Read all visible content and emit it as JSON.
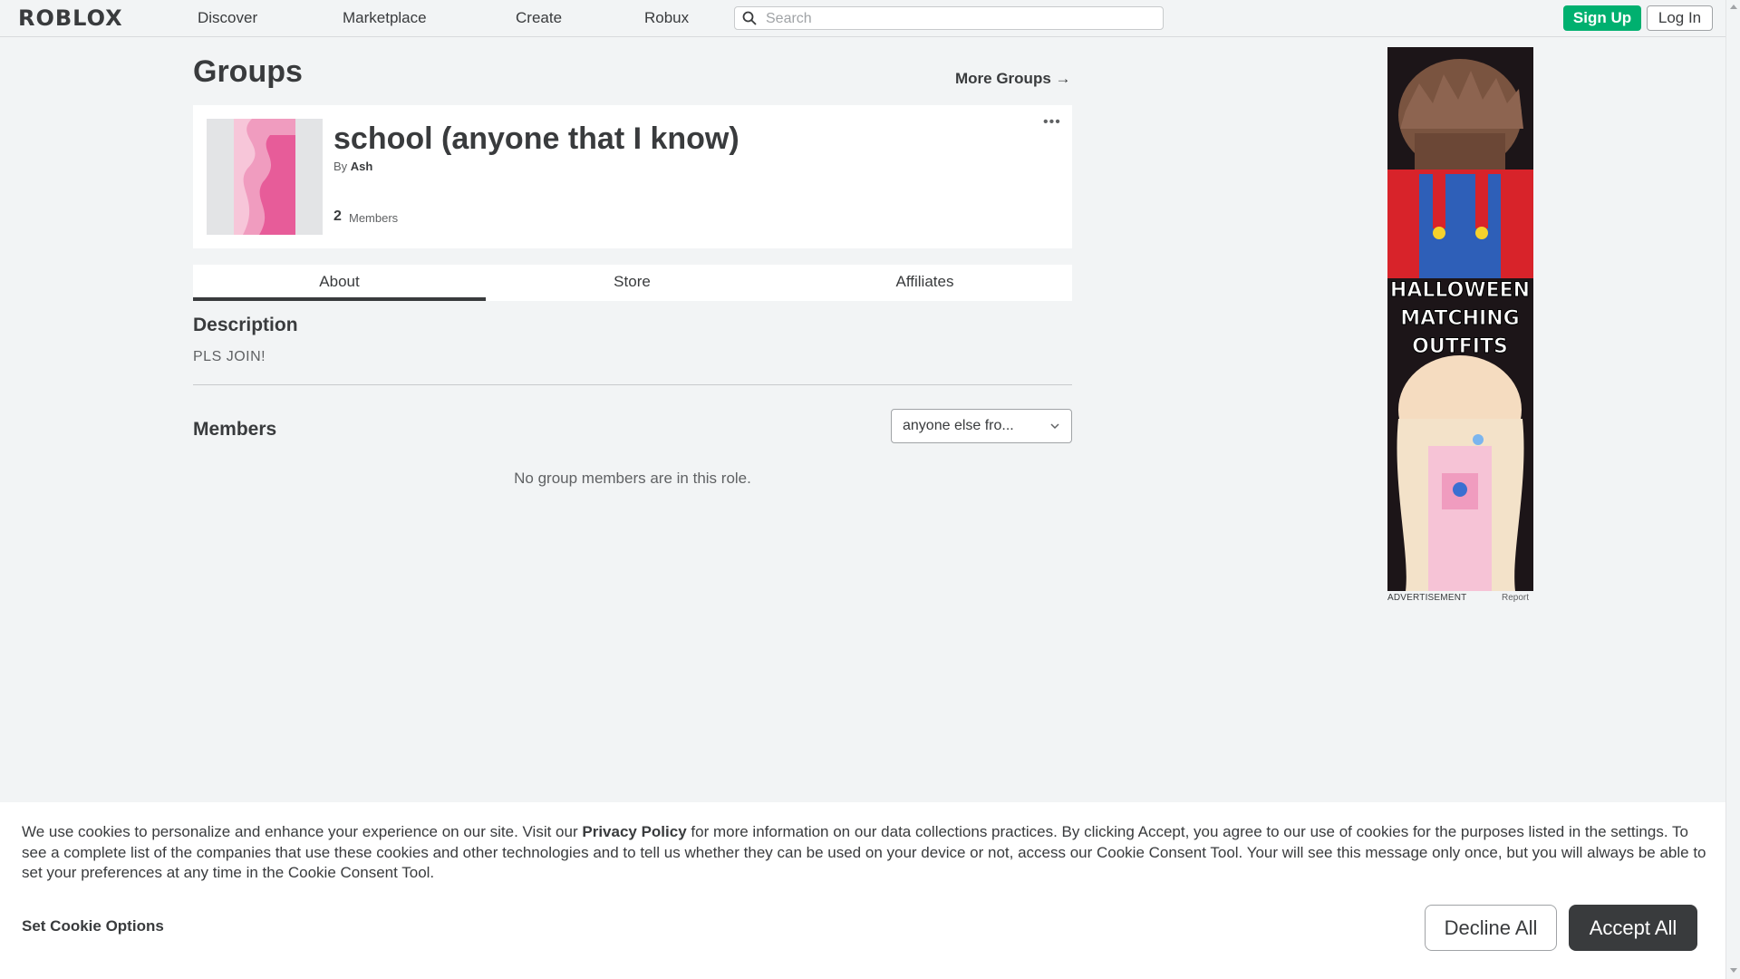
{
  "nav": {
    "logo": "ROBLOX",
    "links": [
      "Discover",
      "Marketplace",
      "Create",
      "Robux"
    ],
    "search_placeholder": "Search",
    "signup": "Sign Up",
    "login": "Log In"
  },
  "page": {
    "title": "Groups",
    "more_groups": "More Groups →"
  },
  "group": {
    "name": "school (anyone that I know)",
    "by_prefix": "By",
    "owner": "Ash",
    "member_count": "2",
    "member_label": "Members",
    "menu_glyph": "•••",
    "emblem_colors": [
      "#f7c6d9",
      "#f09cbf",
      "#e75c99"
    ]
  },
  "tabs": [
    "About",
    "Store",
    "Affiliates"
  ],
  "about": {
    "description_title": "Description",
    "description": "PLS JOIN!",
    "members_title": "Members",
    "role_selected": "anyone else fro...",
    "empty_message": "No group members are in this role."
  },
  "ad": {
    "headline": [
      "HALLOWEEN",
      "MATCHING",
      "OUTFITS"
    ],
    "label": "ADVERTISEMENT",
    "report": "Report"
  },
  "cookie": {
    "text_before": "We use cookies to personalize and enhance your experience on our site. Visit our ",
    "privacy_link": "Privacy Policy",
    "text_after": " for more information on our data collections practices. By clicking Accept, you agree to our use of cookies for the purposes listed in the settings. To see a complete list of the companies that use these cookies and other technologies and to tell us whether they can be used on your device or not, access our Cookie Consent Tool. Your will see this message only once, but you will always be able to set your preferences at any time in the Cookie Consent Tool.",
    "set_options": "Set Cookie Options",
    "decline": "Decline All",
    "accept": "Accept All"
  },
  "colors": {
    "primary_green": "#00b06f",
    "text": "#393b3d",
    "background": "#f2f4f5"
  }
}
